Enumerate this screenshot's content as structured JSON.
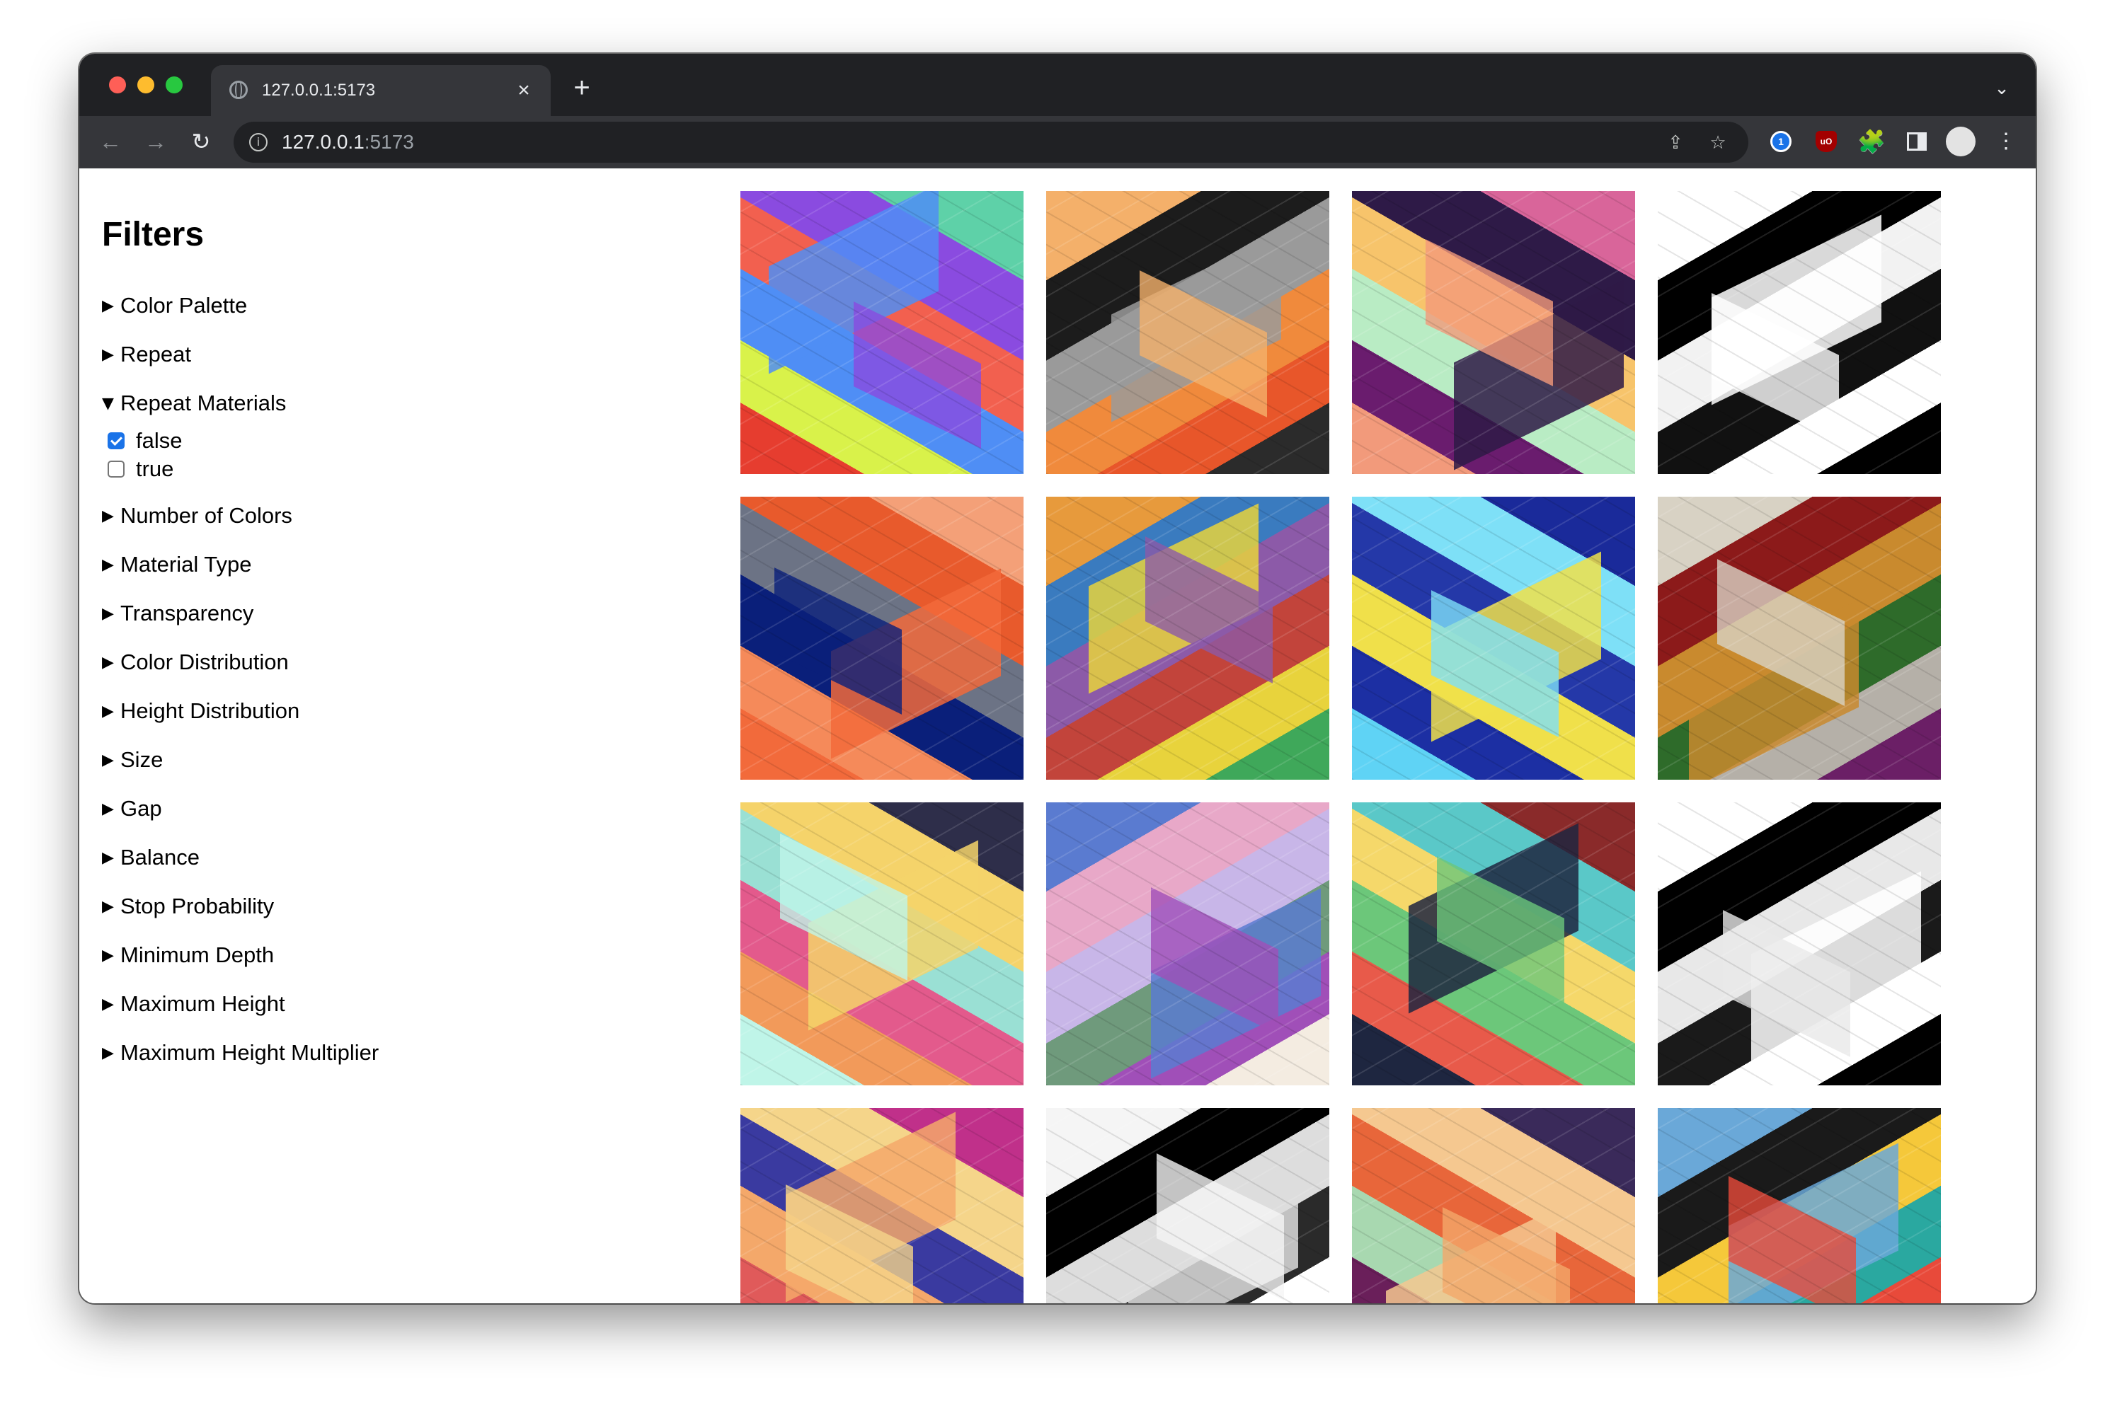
{
  "browser": {
    "tab_title": "127.0.0.1:5173",
    "tab_close": "×",
    "new_tab": "+",
    "tab_menu": "⌄",
    "nav_back": "←",
    "nav_forward": "→",
    "nav_reload": "↻",
    "url_host": "127.0.0.1",
    "url_port": ":5173",
    "share_icon": "⇪",
    "star_icon": "☆",
    "puzzle_icon": "🧩",
    "kebab_icon": "⋮",
    "info_icon": "i",
    "onepassword_label": "1",
    "ublock_label": "uO"
  },
  "sidebar": {
    "title": "Filters",
    "filters": [
      {
        "label": "Color Palette",
        "expanded": false
      },
      {
        "label": "Repeat",
        "expanded": false
      },
      {
        "label": "Repeat Materials",
        "expanded": true,
        "options": [
          {
            "label": "false",
            "checked": true
          },
          {
            "label": "true",
            "checked": false
          }
        ]
      },
      {
        "label": "Number of Colors",
        "expanded": false
      },
      {
        "label": "Material Type",
        "expanded": false
      },
      {
        "label": "Transparency",
        "expanded": false
      },
      {
        "label": "Color Distribution",
        "expanded": false
      },
      {
        "label": "Height Distribution",
        "expanded": false
      },
      {
        "label": "Size",
        "expanded": false
      },
      {
        "label": "Gap",
        "expanded": false
      },
      {
        "label": "Balance",
        "expanded": false
      },
      {
        "label": "Stop Probability",
        "expanded": false
      },
      {
        "label": "Minimum Depth",
        "expanded": false
      },
      {
        "label": "Maximum Height",
        "expanded": false
      },
      {
        "label": "Maximum Height Multiplier",
        "expanded": false
      }
    ],
    "triangle_collapsed": "▶",
    "triangle_expanded": "▼"
  },
  "gallery": {
    "thumbnails": [
      {
        "colors": [
          "#e63d2f",
          "#d9f24a",
          "#4f8ef5",
          "#f2604f",
          "#8a4be0",
          "#5ed1a8"
        ]
      },
      {
        "colors": [
          "#2b2b2b",
          "#e8562a",
          "#f08a3c",
          "#9a9a9a",
          "#1c1c1c",
          "#f4b06a"
        ]
      },
      {
        "colors": [
          "#f29a7b",
          "#6a1c6e",
          "#b9ecc4",
          "#f7c46b",
          "#2e1a47",
          "#d9659a"
        ]
      },
      {
        "colors": [
          "#000000",
          "#ffffff",
          "#111111",
          "#f2f2f2",
          "#000000",
          "#ffffff"
        ]
      },
      {
        "colors": [
          "#f26a3b",
          "#f58a5a",
          "#0a1f7a",
          "#6c7385",
          "#e85a2c",
          "#f4a078"
        ]
      },
      {
        "colors": [
          "#3fa85a",
          "#e8d33c",
          "#c2443b",
          "#8c5aa8",
          "#3a7bbf",
          "#e79a3c"
        ]
      },
      {
        "colors": [
          "#5fd3f5",
          "#1c2fa3",
          "#f0e04a",
          "#2438a8",
          "#7ee0f7",
          "#1a2a9a"
        ]
      },
      {
        "colors": [
          "#6b1f66",
          "#b5b0a8",
          "#2e6b2a",
          "#c98a2e",
          "#8c1a1a",
          "#d8d2c4"
        ]
      },
      {
        "colors": [
          "#bff5e8",
          "#f29a5a",
          "#e35a8c",
          "#9ae0d4",
          "#f5d36a",
          "#2e2e4a"
        ]
      },
      {
        "colors": [
          "#f4ece1",
          "#a04fb8",
          "#6f9a7c",
          "#c8b6e8",
          "#e8a8c8",
          "#5a7bd0"
        ]
      },
      {
        "colors": [
          "#1e2640",
          "#e85a4a",
          "#6cc77a",
          "#f5d86a",
          "#5ac8c8",
          "#8a2a2a"
        ]
      },
      {
        "colors": [
          "#000000",
          "#ffffff",
          "#1a1a1a",
          "#e8e8e8",
          "#000000",
          "#ffffff"
        ]
      },
      {
        "colors": [
          "#6a1a6a",
          "#e05a5a",
          "#f4a86a",
          "#3a3aa0",
          "#f5d58a",
          "#c0308a"
        ]
      },
      {
        "colors": [
          "#000000",
          "#ffffff",
          "#2a2a2a",
          "#dddddd",
          "#000000",
          "#f5f5f5"
        ]
      },
      {
        "colors": [
          "#f2a86a",
          "#6a1f5a",
          "#a8d8b0",
          "#e8663a",
          "#f5c890",
          "#3a2a5a"
        ]
      },
      {
        "colors": [
          "#fbf7ea",
          "#e84a3a",
          "#2aa8a0",
          "#f5c83a",
          "#1a1a1a",
          "#6aa8d8"
        ]
      }
    ]
  }
}
